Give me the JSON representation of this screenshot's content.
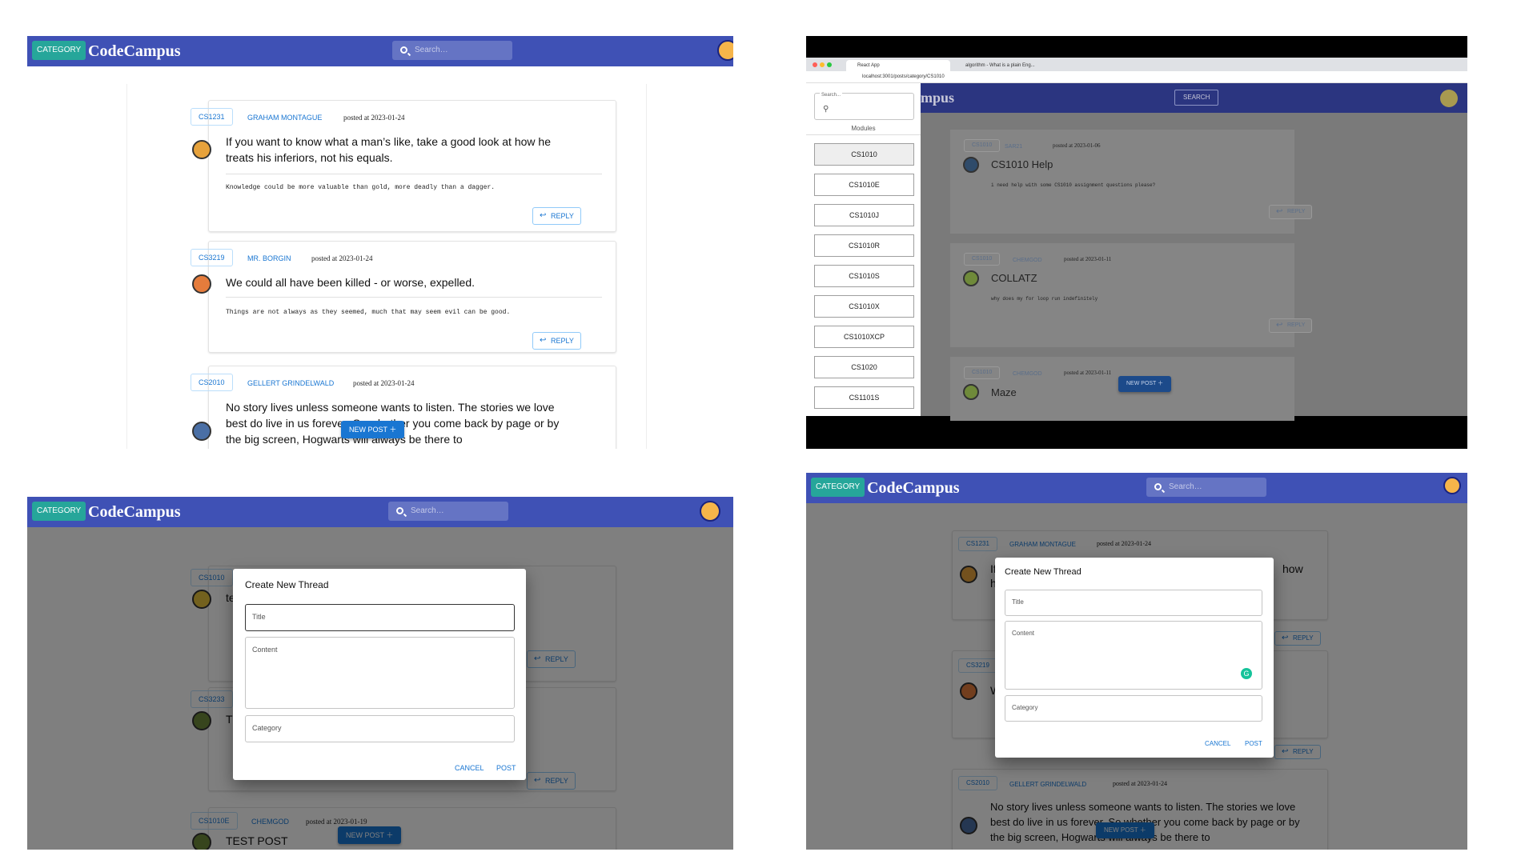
{
  "app": {
    "category_label": "CATEGORY",
    "brand": "CodeCampus",
    "search_placeholder": "Search…",
    "brand_partial": "mpus",
    "search_button": "SEARCH"
  },
  "posts": [
    {
      "chip": "CS1231",
      "author": "GRAHAM MONTAGUE",
      "posted": "posted at 2023-01-24",
      "title": "If you want to know what a man’s like, take a good look at how he treats his inferiors, not his equals.",
      "body": "Knowledge could be more valuable than gold, more deadly than a dagger.",
      "reply": "REPLY"
    },
    {
      "chip": "CS3219",
      "author": "MR. BORGIN",
      "posted": "posted at 2023-01-24",
      "title": "We could all have been killed - or worse, expelled.",
      "body": "Things are not always as they seemed, much that may seem evil can be good.",
      "reply": "REPLY"
    },
    {
      "chip": "CS2010",
      "author": "GELLERT GRINDELWALD",
      "posted": "posted at 2023-01-24",
      "title": "No story lives unless someone wants to listen. The stories we love best do live in us forever. So whether you come back by page or by the big screen, Hogwarts will always be there to"
    }
  ],
  "new_post": "NEW POST",
  "browser": {
    "tab1": "React App",
    "tab2": "algorithm - What is a plain Eng...",
    "url": "localhost:3001/posts/category/CS1010",
    "search_label": "Search...",
    "modules_label": "Modules",
    "modules": [
      "CS1010",
      "CS1010E",
      "CS1010J",
      "CS1010R",
      "CS1010S",
      "CS1010X",
      "CS1010XCP",
      "CS1020",
      "CS1101S"
    ],
    "posts": [
      {
        "chip": "CS1010",
        "author": "SAR21",
        "posted": "posted at 2023-01-06",
        "title": "CS1010 Help",
        "body": "i need help with some CS1010 assignment questions please?",
        "reply": "REPLY"
      },
      {
        "chip": "CS1010",
        "author": "CHEMGOD",
        "posted": "posted at 2023-01-11",
        "title": "COLLATZ",
        "body": "why does my for loop run indefinitely",
        "reply": "REPLY"
      },
      {
        "chip": "CS1010",
        "author": "CHEMGOD",
        "posted": "posted at 2023-01-11",
        "title": "Maze"
      }
    ]
  },
  "modal": {
    "title": "Create New Thread",
    "title_field": "Title",
    "content_field": "Content",
    "category_field": "Category",
    "cancel": "CANCEL",
    "post": "POST"
  },
  "panel3_bg": {
    "chip1": "CS1010",
    "chip2": "CS3233",
    "chip3": "CS1010E",
    "author3": "CHEMGOD",
    "posted3": "posted at 2023-01-19",
    "title3": "TEST POST",
    "letter1": "te",
    "letter2": "T",
    "reply": "REPLY"
  },
  "panel4_bg": {
    "chip1": "CS1231",
    "author1": "GRAHAM MONTAGUE",
    "posted1": "posted at 2023-01-24",
    "chip2": "CS3219",
    "chip3": "CS2010",
    "author3": "GELLERT GRINDELWALD",
    "posted3": "posted at 2023-01-24",
    "frag_how": "how",
    "frag_if": "If",
    "frag_h": "h",
    "frag_w": "W",
    "reply": "REPLY",
    "title3": "No story lives unless someone wants to listen. The stories we love best do live in us forever. So whether you come back by page or by the big screen, Hogwarts will always be there to"
  }
}
